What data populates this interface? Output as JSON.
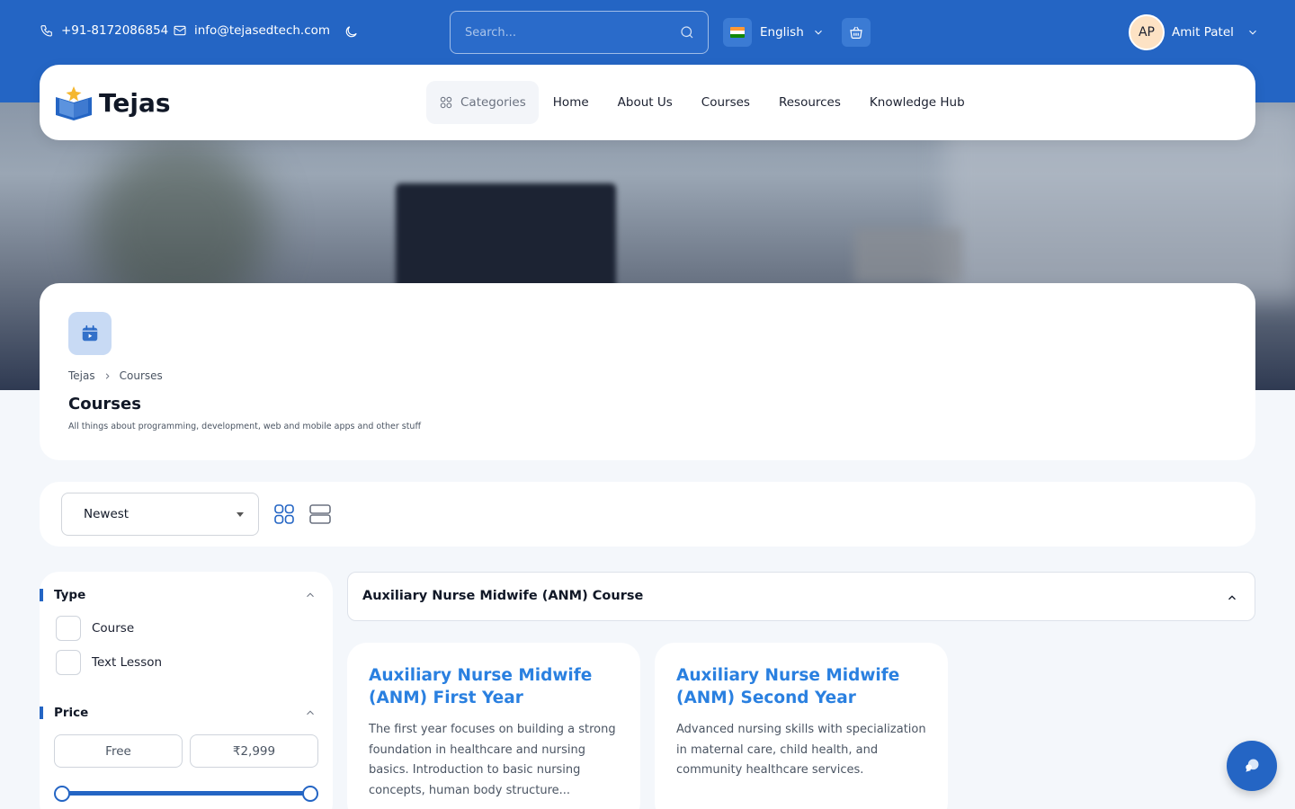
{
  "topbar": {
    "phone": "+91-8172086854",
    "email": "info@tejasedtech.com",
    "search_placeholder": "Search...",
    "language": "English",
    "user_initials": "AP",
    "user_name": "Amit Patel"
  },
  "brand": {
    "name": "Tejas"
  },
  "nav": {
    "categories": "Categories",
    "items": [
      "Home",
      "About Us",
      "Courses",
      "Resources",
      "Knowledge Hub"
    ]
  },
  "page": {
    "breadcrumb": [
      "Tejas",
      "Courses"
    ],
    "title": "Courses",
    "subtitle": "All things about programming, development, web and mobile apps and other stuff"
  },
  "sort": {
    "selected": "Newest"
  },
  "filters": {
    "type_label": "Type",
    "type_options": [
      "Course",
      "Text Lesson"
    ],
    "price_label": "Price",
    "price_min": "Free",
    "price_max": "₹2,999"
  },
  "accordion": {
    "title": "Auxiliary Nurse Midwife (ANM) Course"
  },
  "courses": [
    {
      "title": "Auxiliary Nurse Midwife (ANM) First Year",
      "description": "The first year focuses on building a strong foundation in healthcare and nursing basics. Introduction to basic nursing concepts, human body structure..."
    },
    {
      "title": "Auxiliary Nurse Midwife (ANM) Second Year",
      "description": "Advanced nursing skills with specialization in maternal care, child health, and community healthcare services."
    }
  ],
  "colors": {
    "primary": "#2465c4",
    "card_title": "#2a80e0"
  }
}
